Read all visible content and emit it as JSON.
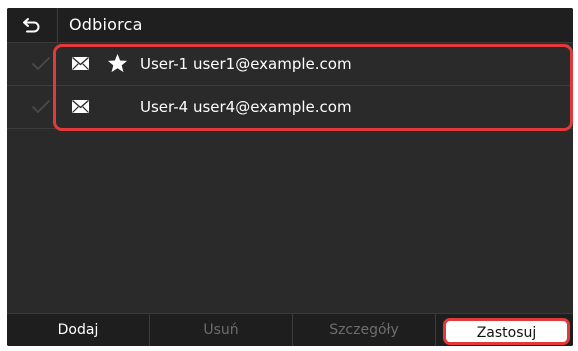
{
  "header": {
    "title": "Odbiorca"
  },
  "recipients": [
    {
      "label": "User-1 user1@example.com",
      "favorite": true
    },
    {
      "label": "User-4 user4@example.com",
      "favorite": false
    }
  ],
  "toolbar": {
    "add_label": "Dodaj",
    "delete_label": "Usuń",
    "details_label": "Szczegóły",
    "apply_label": "Zastosuj"
  },
  "colors": {
    "highlight": "#e23a3a",
    "background": "#2a2a2a",
    "text": "#ffffff",
    "disabled_text": "#6d6d6d"
  },
  "icons": {
    "back": "back-arrow-icon",
    "check": "checkmark-icon",
    "mail": "envelope-icon",
    "favorite": "star-icon"
  }
}
